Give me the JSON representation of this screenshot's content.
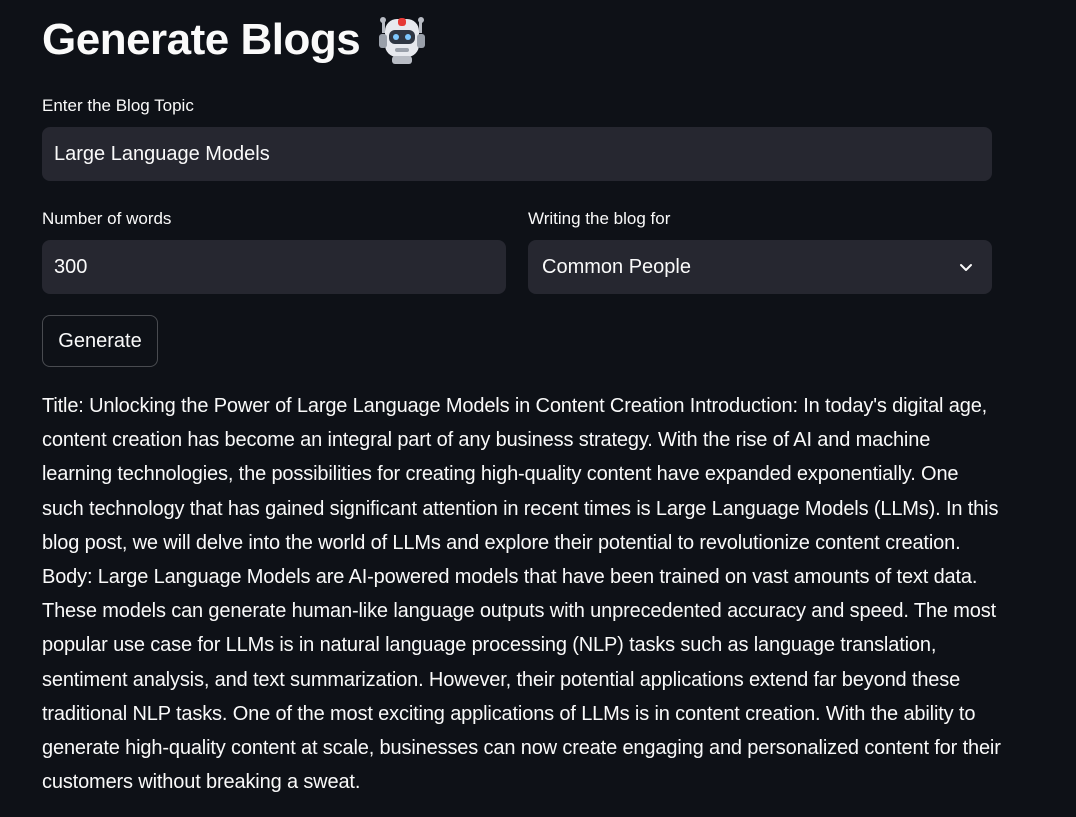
{
  "page": {
    "title": "Generate Blogs",
    "title_icon": "robot-emoji-icon"
  },
  "form": {
    "topic_label": "Enter the Blog Topic",
    "topic_value": "Large Language Models",
    "words_label": "Number of words",
    "words_value": "300",
    "audience_label": "Writing the blog for",
    "audience_value": "Common People",
    "audience_icon": "chevron-down-icon",
    "generate_label": "Generate"
  },
  "output": {
    "text": "Title: Unlocking the Power of Large Language Models in Content Creation Introduction: In today's digital age, content creation has become an integral part of any business strategy. With the rise of AI and machine learning technologies, the possibilities for creating high-quality content have expanded exponentially. One such technology that has gained significant attention in recent times is Large Language Models (LLMs). In this blog post, we will delve into the world of LLMs and explore their potential to revolutionize content creation. Body: Large Language Models are AI-powered models that have been trained on vast amounts of text data. These models can generate human-like language outputs with unprecedented accuracy and speed. The most popular use case for LLMs is in natural language processing (NLP) tasks such as language translation, sentiment analysis, and text summarization. However, their potential applications extend far beyond these traditional NLP tasks. One of the most exciting applications of LLMs is in content creation. With the ability to generate high-quality content at scale, businesses can now create engaging and personalized content for their customers without breaking a sweat."
  },
  "colors": {
    "background": "#0e1117",
    "input_bg": "#262730",
    "text": "#fafafa"
  }
}
